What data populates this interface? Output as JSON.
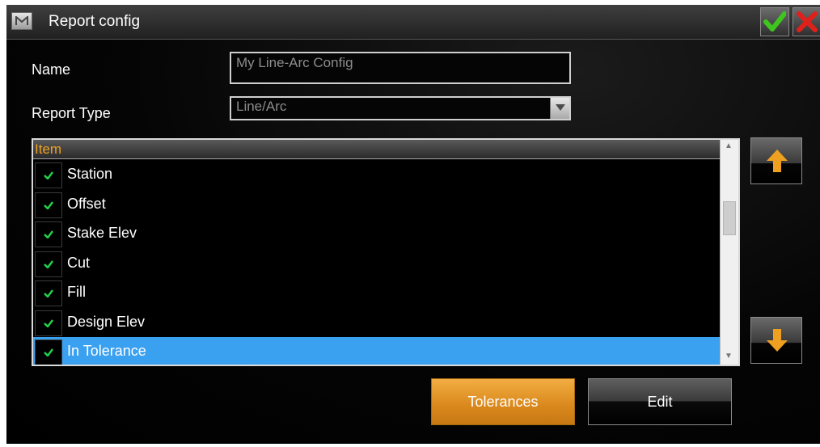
{
  "window": {
    "title": "Report config",
    "accent_color": "#3aa0f0",
    "button_color": "#e39424"
  },
  "form": {
    "name_label": "Name",
    "name_value": "My Line-Arc Config",
    "report_type_label": "Report Type",
    "report_type_value": "Line/Arc"
  },
  "list": {
    "header": "Item",
    "items": [
      {
        "label": "Station",
        "checked": true
      },
      {
        "label": "Offset",
        "checked": true
      },
      {
        "label": "Stake Elev",
        "checked": true
      },
      {
        "label": "Cut",
        "checked": true
      },
      {
        "label": "Fill",
        "checked": true
      },
      {
        "label": "Design Elev",
        "checked": true
      },
      {
        "label": "In Tolerance",
        "checked": true,
        "selected": true
      }
    ]
  },
  "buttons": {
    "tolerances_label": "Tolerances",
    "edit_label": "Edit"
  },
  "icons": {
    "app": "app-icon",
    "accept": "checkmark-icon",
    "cancel": "close-icon",
    "move_up": "arrow-up-icon",
    "move_down": "arrow-down-icon",
    "dropdown": "chevron-down-icon"
  }
}
